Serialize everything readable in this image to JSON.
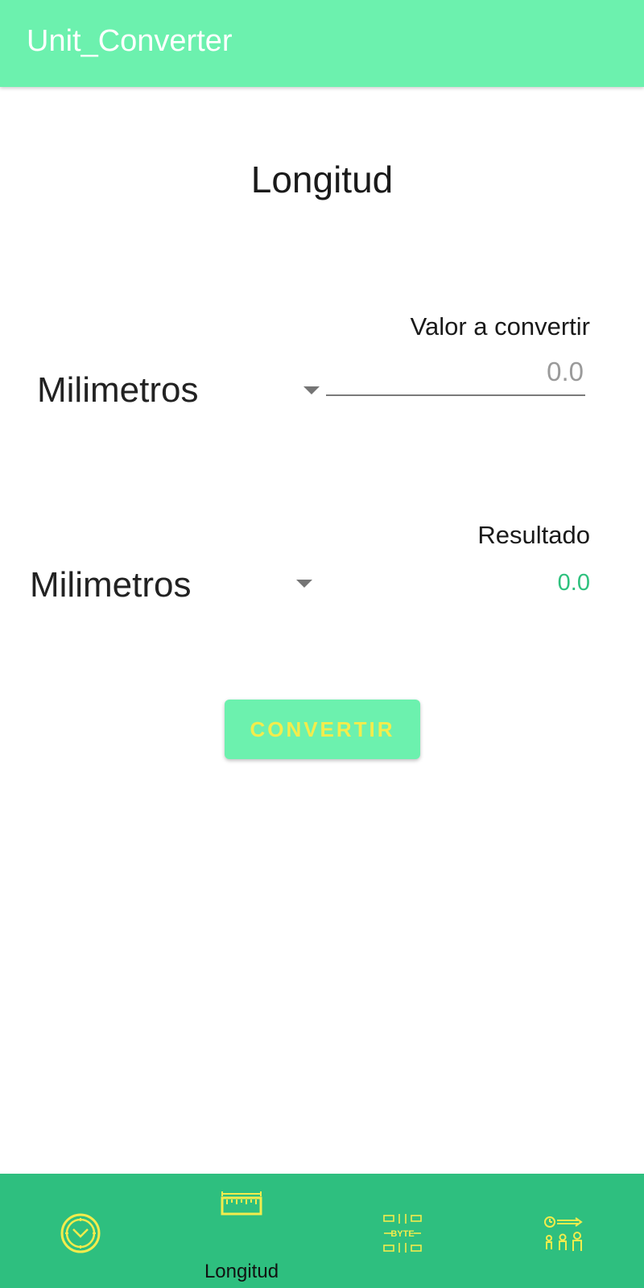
{
  "appbar": {
    "title": "Unit_Converter"
  },
  "main": {
    "section_title": "Longitud",
    "input_label": "Valor a convertir",
    "from_unit": "Milimetros",
    "input_placeholder": "0.0",
    "result_label": "Resultado",
    "to_unit": "Milimetros",
    "result_value": "0.0",
    "convert_label": "CONVERTIR"
  },
  "bottom_nav": {
    "items": [
      {
        "icon": "clock-icon",
        "label": ""
      },
      {
        "icon": "ruler-icon",
        "label": "Longitud",
        "active": true
      },
      {
        "icon": "byte-icon",
        "label": ""
      },
      {
        "icon": "speed-icon",
        "label": ""
      }
    ]
  },
  "colors": {
    "primary": "#6cf1ae",
    "primary_dark": "#2ebf7f",
    "accent": "#f3ec4c",
    "result_text": "#2ec17e"
  }
}
